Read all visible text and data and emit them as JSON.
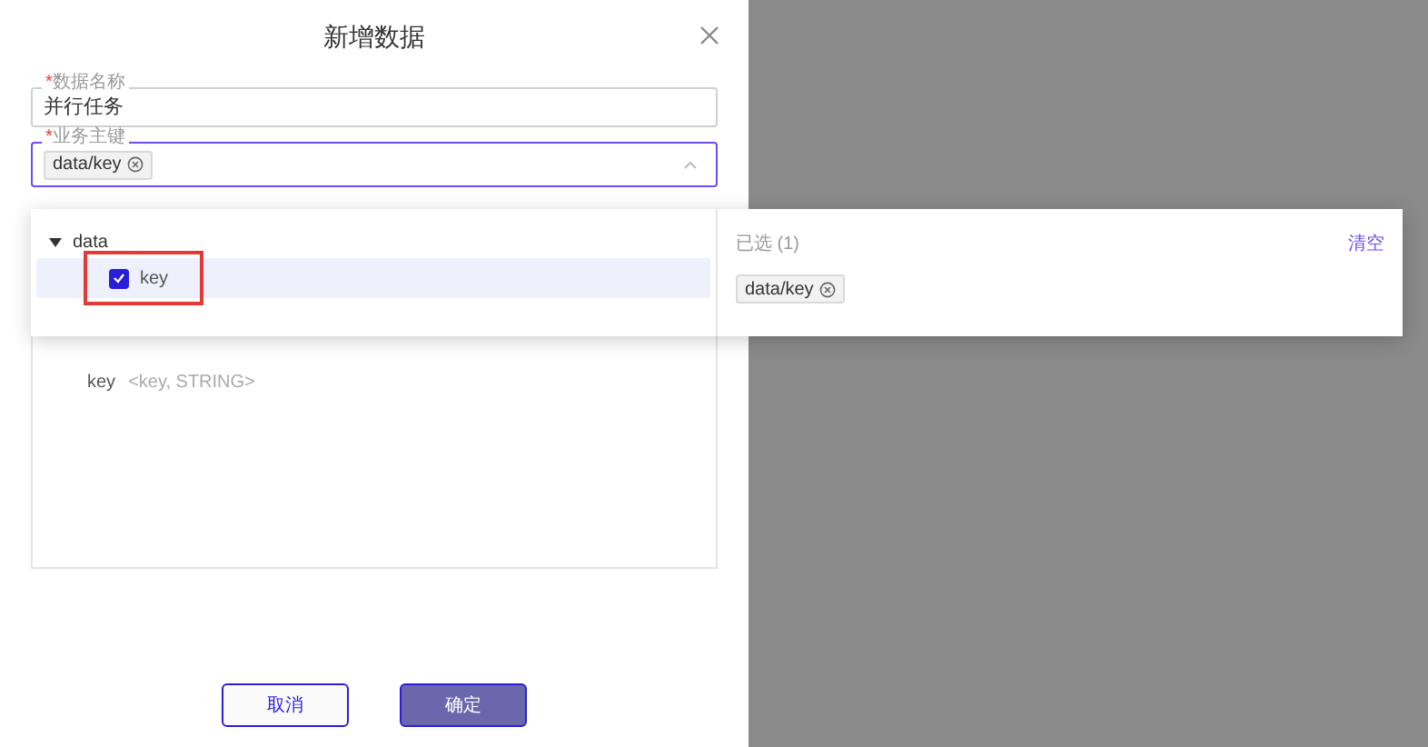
{
  "dialog": {
    "title": "新增数据"
  },
  "fields": [
    {
      "required_mark": "*",
      "label": "数据名称",
      "value": "并行任务",
      "focused": false
    },
    {
      "required_mark": "*",
      "label": "业务主键",
      "tags": [
        "data/key"
      ],
      "focused": true
    }
  ],
  "tree": [
    {
      "label": "data",
      "expanded": true,
      "children": [
        {
          "label": "key",
          "checked": true,
          "selected": true,
          "highlighted": true
        }
      ]
    }
  ],
  "selected_panel": {
    "title": "已选 (1)",
    "clear": "清空",
    "tags": [
      "data/key"
    ]
  },
  "schema": [
    {
      "name": "key",
      "type": "<key, STRING>"
    }
  ],
  "buttons": [
    {
      "label": "取消",
      "kind": "secondary"
    },
    {
      "label": "确定",
      "kind": "primary"
    }
  ]
}
